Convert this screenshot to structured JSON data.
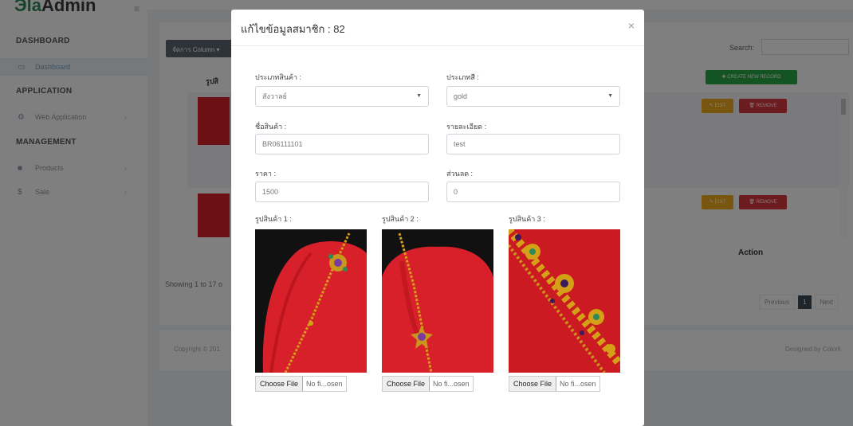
{
  "app": {
    "logo_mark": "Э",
    "logo_accent": "la",
    "logo_text": "Admin"
  },
  "sidebar": {
    "sections": [
      {
        "title": "DASHBOARD"
      },
      {
        "title": "APPLICATION"
      },
      {
        "title": "MANAGEMENT"
      }
    ],
    "items": [
      {
        "label": "Dashboard",
        "icon": "laptop-icon"
      },
      {
        "label": "Web Application",
        "icon": "cogs-icon"
      },
      {
        "label": "Products",
        "icon": "box-icon"
      },
      {
        "label": "Sale",
        "icon": "dollar-icon"
      }
    ]
  },
  "page": {
    "columns_button": "จัดการ Column ▾",
    "search_label": "Search:",
    "create_button": "✚ CREATE NEW RECORD",
    "photo_header": "รูปสิ",
    "action_header": "Action",
    "edit_label": "✎ EDIT",
    "remove_label": "🗑 REMOVE",
    "showing_text": "Showing 1 to 17 o",
    "pager": {
      "prev": "Previous",
      "current": "1",
      "next": "Next"
    },
    "copyright": "Copyright © 201",
    "designed_by": "Designed by Colorli"
  },
  "modal": {
    "title": "แก้ไขข้อมูลสมาชิก : 82",
    "close": "×",
    "fields": {
      "product_type": {
        "label": "ประเภทสินค้า :",
        "value": "สังวาลย์"
      },
      "color_type": {
        "label": "ประเภทสี :",
        "value": "gold"
      },
      "product_name": {
        "label": "ชื่อสินค้า :",
        "value": "BR06111101"
      },
      "detail": {
        "label": "รายละเอียด :",
        "value": "test"
      },
      "price": {
        "label": "ราคา :",
        "value": "1500"
      },
      "discount": {
        "label": "ส่วนลด :",
        "value": "0"
      }
    },
    "images": [
      {
        "label": "รูปสินค้า 1 :",
        "choose": "Choose File",
        "file": "No fi...osen"
      },
      {
        "label": "รูปสินค้า 2 :",
        "choose": "Choose File",
        "file": "No fi...osen"
      },
      {
        "label": "รูปสินค้า 3 :",
        "choose": "Choose File",
        "file": "No fi...osen"
      }
    ]
  },
  "colors": {
    "accent_green": "#28a745",
    "edit_yellow": "#f0ad1e",
    "remove_red": "#d9363e",
    "fabric_red": "#d8202a",
    "gold": "#d4a017"
  }
}
